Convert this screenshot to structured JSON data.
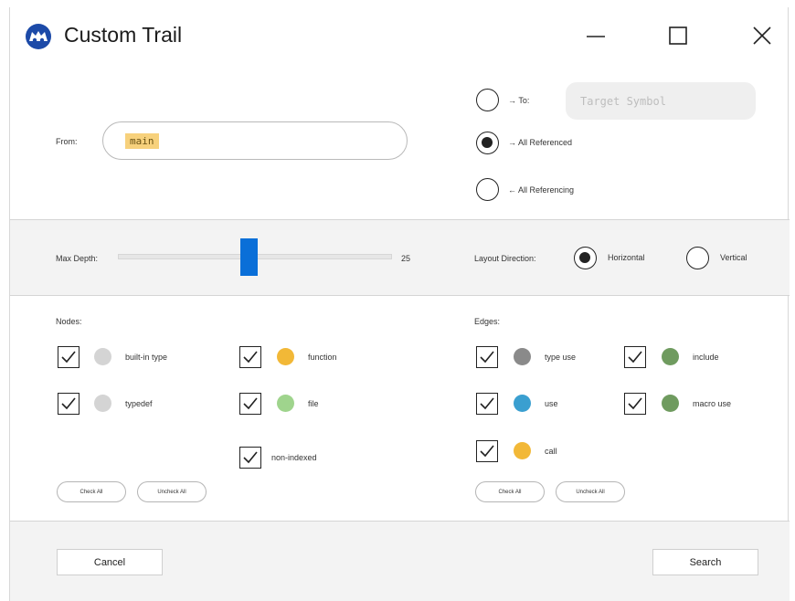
{
  "window": {
    "title": "Custom Trail"
  },
  "from": {
    "label": "From:",
    "value": "main"
  },
  "target": {
    "to_label": "→ To:",
    "to_placeholder": "Target Symbol",
    "all_referenced_label": "→ All Referenced",
    "all_referencing_label": "← All Referencing",
    "selected": "all_referenced"
  },
  "depth": {
    "label": "Max Depth:",
    "value": "25",
    "fraction": 0.47
  },
  "layout": {
    "label": "Layout Direction:",
    "horizontal_label": "Horizontal",
    "vertical_label": "Vertical",
    "selected": "horizontal"
  },
  "nodes": {
    "label": "Nodes:",
    "items": [
      {
        "label": "built-in type",
        "checked": true,
        "color": "#d4d4d4"
      },
      {
        "label": "typedef",
        "checked": true,
        "color": "#d4d4d4"
      },
      {
        "label": "function",
        "checked": true,
        "color": "#f2b837"
      },
      {
        "label": "file",
        "checked": true,
        "color": "#9fd48d"
      },
      {
        "label": "non-indexed",
        "checked": true
      }
    ],
    "check_all": "Check All",
    "uncheck_all": "Uncheck All"
  },
  "edges": {
    "label": "Edges:",
    "items": [
      {
        "label": "type use",
        "checked": true,
        "color": "#8a8a8a"
      },
      {
        "label": "use",
        "checked": true,
        "color": "#3a9fd0"
      },
      {
        "label": "call",
        "checked": true,
        "color": "#f2b837"
      },
      {
        "label": "include",
        "checked": true,
        "color": "#6f9b5f"
      },
      {
        "label": "macro use",
        "checked": true,
        "color": "#6f9b5f"
      }
    ],
    "check_all": "Check All",
    "uncheck_all": "Uncheck All"
  },
  "footer": {
    "cancel": "Cancel",
    "search": "Search"
  },
  "colors": {
    "accent": "#0a6fd8",
    "highlight": "#f7d17c"
  }
}
